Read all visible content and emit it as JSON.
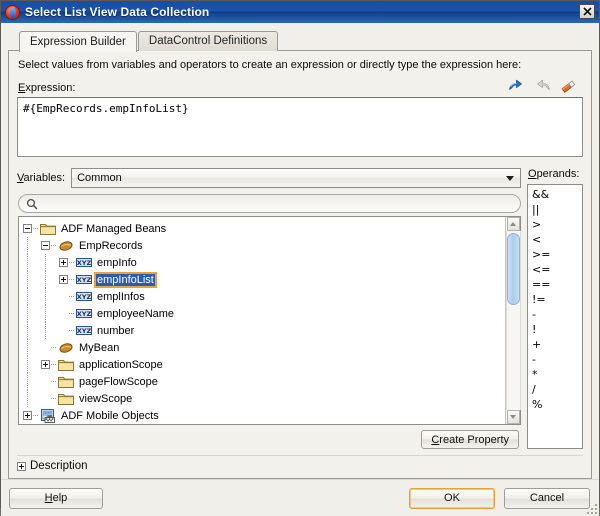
{
  "window": {
    "title": "Select List View Data Collection",
    "icon": "jdeveloper-info-icon",
    "close_label": "✕"
  },
  "tabs": [
    {
      "label": "Expression Builder",
      "active": true
    },
    {
      "label": "DataControl Definitions",
      "active": false
    }
  ],
  "hint": "Select values from variables and operators to create an expression or directly type the expression here:",
  "expression": {
    "label": "Expression:",
    "label_mnemonic": "E",
    "value": "#{EmpRecords.empInfoList}",
    "tools": [
      {
        "name": "undo-icon",
        "enabled": true
      },
      {
        "name": "redo-icon",
        "enabled": false
      },
      {
        "name": "eraser-icon",
        "enabled": true
      }
    ]
  },
  "variables": {
    "label": "Variables:",
    "label_mnemonic": "V",
    "selected": "Common",
    "options": [
      "Common"
    ],
    "search_placeholder": "",
    "search_value": ""
  },
  "tree": [
    {
      "label": "ADF Managed Beans",
      "depth": 0,
      "toggle": "minus",
      "icon": "folder-icon",
      "selected": false
    },
    {
      "label": "EmpRecords",
      "depth": 1,
      "toggle": "minus",
      "icon": "bean-icon",
      "selected": false
    },
    {
      "label": "empInfo",
      "depth": 2,
      "toggle": "plus",
      "icon": "xyz-icon",
      "selected": false
    },
    {
      "label": "empInfoList",
      "depth": 2,
      "toggle": "plus",
      "icon": "xyz-icon",
      "selected": true
    },
    {
      "label": "emplInfos",
      "depth": 2,
      "toggle": "none",
      "icon": "xyz-icon",
      "selected": false
    },
    {
      "label": "employeeName",
      "depth": 2,
      "toggle": "none",
      "icon": "xyz-icon",
      "selected": false
    },
    {
      "label": "number",
      "depth": 2,
      "toggle": "none",
      "icon": "xyz-icon",
      "selected": false
    },
    {
      "label": "MyBean",
      "depth": 1,
      "toggle": "none",
      "icon": "bean-icon",
      "selected": false
    },
    {
      "label": "applicationScope",
      "depth": 1,
      "toggle": "plus",
      "icon": "folder-icon",
      "selected": false
    },
    {
      "label": "pageFlowScope",
      "depth": 1,
      "toggle": "none",
      "icon": "folder-icon",
      "selected": false
    },
    {
      "label": "viewScope",
      "depth": 1,
      "toggle": "none",
      "icon": "folder-icon",
      "selected": false
    },
    {
      "label": "ADF Mobile Objects",
      "depth": 0,
      "toggle": "plus",
      "icon": "datacontrol-icon",
      "selected": false
    }
  ],
  "operands": {
    "label": "Operands:",
    "label_mnemonic": "O",
    "items": [
      "&&",
      "||",
      ">",
      "<",
      ">=",
      "<=",
      "==",
      "!=",
      "-",
      "!",
      "+",
      "-",
      "*",
      "/",
      "%"
    ]
  },
  "create_property": {
    "label": "Create Property",
    "mnemonic": "C"
  },
  "description": {
    "label": "Description",
    "expanded": false
  },
  "footer": {
    "help": {
      "label": "Help",
      "mnemonic": "H"
    },
    "ok": {
      "label": "OK",
      "focused": true
    },
    "cancel": {
      "label": "Cancel"
    }
  },
  "colors": {
    "titlebar": "#1a52a8",
    "selection": "#2a5db0",
    "focus_outline": "#e8a33d",
    "dialog_bg": "#f0efe9"
  }
}
